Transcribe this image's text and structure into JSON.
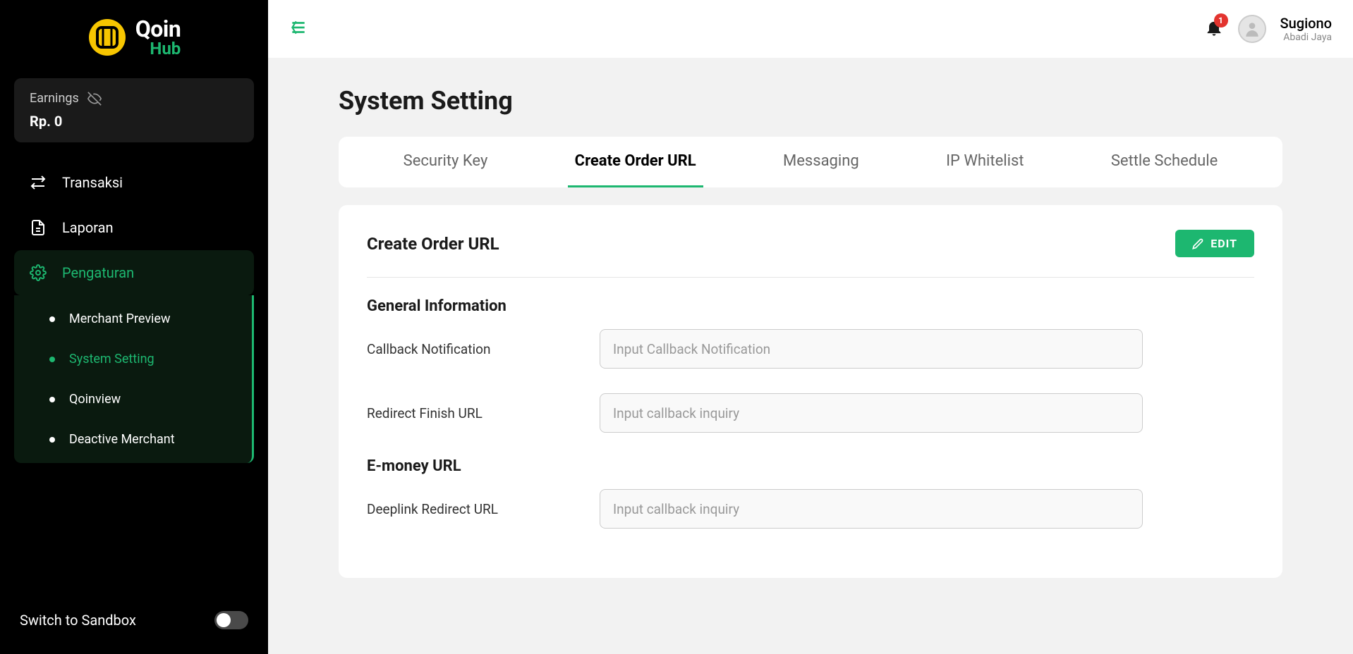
{
  "logo": {
    "brand": "Qoin",
    "sub": "Hub"
  },
  "earnings": {
    "label": "Earnings",
    "amount": "Rp. 0"
  },
  "nav": {
    "transaksi": "Transaksi",
    "laporan": "Laporan",
    "pengaturan": "Pengaturan",
    "sub": {
      "merchant_preview": "Merchant Preview",
      "system_setting": "System Setting",
      "qoinview": "Qoinview",
      "deactive_merchant": "Deactive Merchant"
    }
  },
  "sandbox": {
    "label": "Switch to Sandbox"
  },
  "topbar": {
    "badge": "1",
    "user_name": "Sugiono",
    "user_sub": "Abadi Jaya"
  },
  "page": {
    "title": "System Setting"
  },
  "tabs": {
    "security_key": "Security Key",
    "create_order_url": "Create Order URL",
    "messaging": "Messaging",
    "ip_whitelist": "IP Whitelist",
    "settle_schedule": "Settle Schedule"
  },
  "panel": {
    "title": "Create Order URL",
    "edit": "EDIT",
    "general_info": "General Information",
    "callback_label": "Callback Notification",
    "callback_ph": "Input Callback Notification",
    "redirect_label": "Redirect Finish URL",
    "redirect_ph": "Input callback inquiry",
    "emoney_title": "E-money URL",
    "deeplink_label": "Deeplink Redirect URL",
    "deeplink_ph": "Input callback inquiry"
  }
}
